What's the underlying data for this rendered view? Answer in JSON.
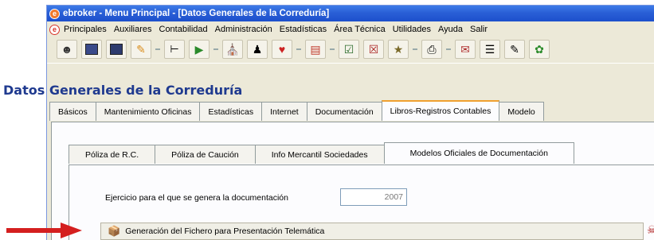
{
  "window": {
    "title": "ebroker - Menu Principal - [Datos Generales de la Correduría]",
    "app_icon": "e"
  },
  "menu": {
    "icon": "e",
    "items": [
      "Principales",
      "Auxiliares",
      "Contabilidad",
      "Administración",
      "Estadísticas",
      "Área Técnica",
      "Utilidades",
      "Ayuda",
      "Salir"
    ]
  },
  "toolbar": {
    "icons": [
      "user-help-icon",
      "policy-icon",
      "receipts-icon",
      "tools-icon",
      "split-icon",
      "export-icon",
      "building-icon",
      "person-icon",
      "heart-icon",
      "chart-icon",
      "check-icon",
      "cancel-icon",
      "money-icon",
      "print-icon",
      "mail-icon",
      "folders-icon",
      "edit-icon",
      "leaf-icon"
    ]
  },
  "form": {
    "title": "Datos Generales de la Correduría",
    "main_tabs": [
      "Básicos",
      "Mantenimiento Oficinas",
      "Estadísticas",
      "Internet",
      "Documentación",
      "Libros-Registros Contables",
      "Modelo"
    ],
    "active_main_tab": "Libros-Registros Contables",
    "sub_tabs": [
      "Póliza de R.C.",
      "Póliza de Caución",
      "Info Mercantil Sociedades",
      "Modelos Oficiales de Documentación"
    ],
    "active_sub_tab": "Modelos Oficiales de Documentación",
    "ejercicio_label": "Ejercicio para el que se genera la documentación",
    "ejercicio_value": "2007",
    "generate_button_label": "Generación del Fichero para Presentación Telemática"
  },
  "colors": {
    "titlebar": "#2a5fd6",
    "form_title": "#1f3a8f",
    "arrow": "#d41f1f"
  }
}
